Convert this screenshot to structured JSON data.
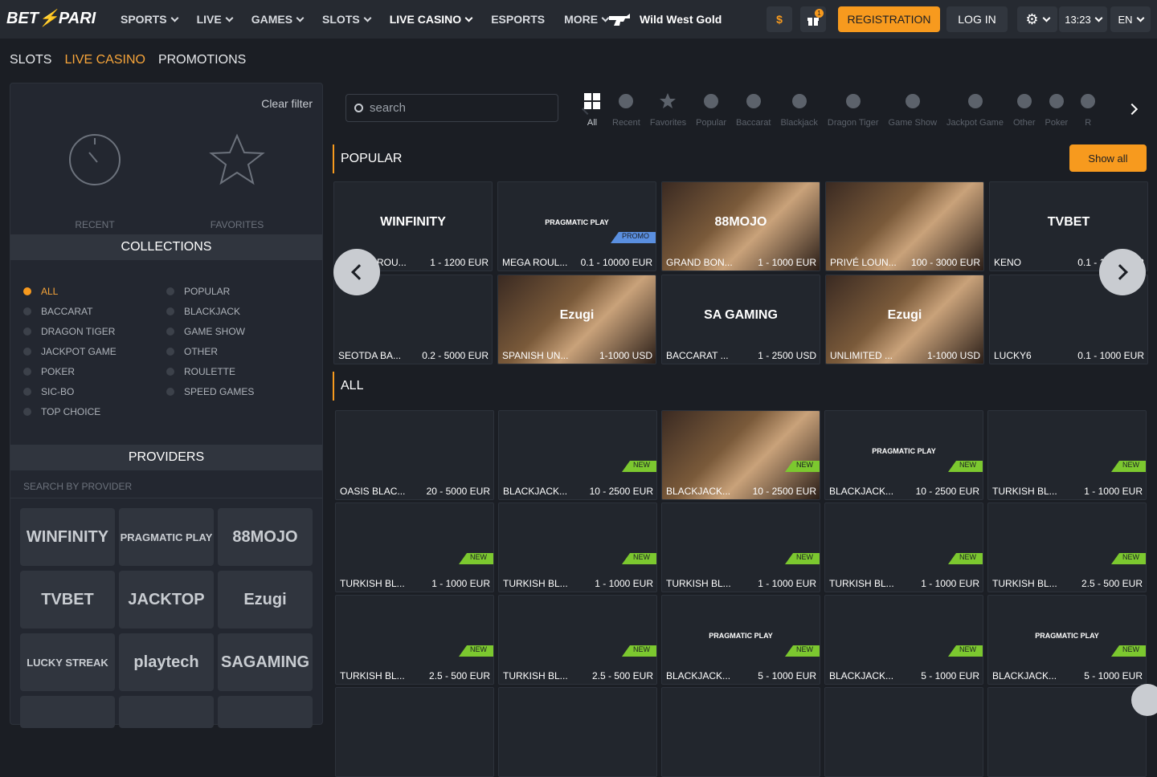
{
  "header": {
    "logo_left": "BET",
    "logo_right": "PARI",
    "nav": [
      {
        "label": "SPORTS",
        "dropdown": true
      },
      {
        "label": "LIVE",
        "dropdown": true
      },
      {
        "label": "GAMES",
        "dropdown": true
      },
      {
        "label": "SLOTS",
        "dropdown": true
      },
      {
        "label": "LIVE CASINO",
        "dropdown": true
      },
      {
        "label": "ESPORTS",
        "dropdown": false
      },
      {
        "label": "MORE",
        "dropdown": true
      }
    ],
    "promo_label": "Wild West Gold",
    "gift_count": "1",
    "registration": "REGISTRATION",
    "login": "LOG IN",
    "time": "13:23",
    "language": "EN",
    "currency_icon": "dollar-icon",
    "accent": "#f79a1e"
  },
  "subnav": [
    {
      "label": "SLOTS",
      "active": false
    },
    {
      "label": "LIVE CASINO",
      "active": true
    },
    {
      "label": "PROMOTIONS",
      "active": false
    }
  ],
  "sidebar": {
    "clear_filter": "Clear filter",
    "recent": "RECENT",
    "favorites": "FAVORITES",
    "collections_title": "COLLECTIONS",
    "collections_left": [
      "ALL",
      "BACCARAT",
      "DRAGON TIGER",
      "JACKPOT GAME",
      "POKER",
      "SIC-BO",
      "TOP CHOICE"
    ],
    "collections_right": [
      "POPULAR",
      "BLACKJACK",
      "GAME SHOW",
      "OTHER",
      "ROULETTE",
      "SPEED GAMES"
    ],
    "active_collection": "ALL",
    "providers_title": "PROVIDERS",
    "provider_search_placeholder": "SEARCH BY PROVIDER",
    "providers": [
      "WINFINITY",
      "PRAGMATIC PLAY",
      "88MOJO",
      "TVBET",
      "JACKTOP",
      "Ezugi",
      "LUCKY STREAK",
      "playtech",
      "SAGAMING"
    ]
  },
  "main": {
    "search_placeholder": "search",
    "categories": [
      "All",
      "Recent",
      "Favorites",
      "Popular",
      "Baccarat",
      "Blackjack",
      "Dragon Tiger",
      "Game Show",
      "Jackpot Game",
      "Other",
      "Poker",
      "R"
    ],
    "popular_title": "POPULAR",
    "show_all": "Show all",
    "all_title": "ALL",
    "popular": [
      {
        "name": "VENICE ROU...",
        "range": "1 - 1200 EUR",
        "logo": "WINFINITY",
        "badge": ""
      },
      {
        "name": "MEGA ROUL...",
        "range": "0.1 - 10000 EUR",
        "logo": "PRAGMATIC PLAY",
        "badge": "PROMO"
      },
      {
        "name": "GRAND BON...",
        "range": "1 - 1000 EUR",
        "logo": "88MOJO",
        "badge": ""
      },
      {
        "name": "PRIVÉ LOUN...",
        "range": "100 - 3000 EUR",
        "logo": "",
        "badge": ""
      },
      {
        "name": "KENO",
        "range": "0.1 - 1000 EUR",
        "logo": "TVBET",
        "badge": ""
      },
      {
        "name": "SEOTDA BA...",
        "range": "0.2 - 5000 EUR",
        "logo": "",
        "badge": ""
      },
      {
        "name": "SPANISH UN...",
        "range": "1-1000 USD",
        "logo": "Ezugi",
        "badge": ""
      },
      {
        "name": "BACCARAT ...",
        "range": "1 - 2500 USD",
        "logo": "SA GAMING",
        "badge": ""
      },
      {
        "name": "UNLIMITED ...",
        "range": "1-1000 USD",
        "logo": "Ezugi",
        "badge": ""
      },
      {
        "name": "LUCKY6",
        "range": "0.1 - 1000 EUR",
        "logo": "",
        "badge": ""
      }
    ],
    "all": [
      {
        "name": "OASIS BLAC...",
        "range": "20 - 5000 EUR",
        "logo": "",
        "badge": ""
      },
      {
        "name": "BLACKJACK...",
        "range": "10 - 2500 EUR",
        "logo": "",
        "badge": "NEW"
      },
      {
        "name": "BLACKJACK...",
        "range": "10 - 2500 EUR",
        "logo": "",
        "badge": "NEW"
      },
      {
        "name": "BLACKJACK...",
        "range": "10 - 2500 EUR",
        "logo": "PRAGMATIC PLAY",
        "badge": "NEW"
      },
      {
        "name": "TURKISH BL...",
        "range": "1 - 1000 EUR",
        "logo": "",
        "badge": "NEW"
      },
      {
        "name": "TURKISH BL...",
        "range": "1 - 1000 EUR",
        "logo": "",
        "badge": "NEW"
      },
      {
        "name": "TURKISH BL...",
        "range": "1 - 1000 EUR",
        "logo": "",
        "badge": "NEW"
      },
      {
        "name": "TURKISH BL...",
        "range": "1 - 1000 EUR",
        "logo": "",
        "badge": "NEW"
      },
      {
        "name": "TURKISH BL...",
        "range": "1 - 1000 EUR",
        "logo": "",
        "badge": "NEW"
      },
      {
        "name": "TURKISH BL...",
        "range": "2.5 - 500 EUR",
        "logo": "",
        "badge": "NEW"
      },
      {
        "name": "TURKISH BL...",
        "range": "2.5 - 500 EUR",
        "logo": "",
        "badge": "NEW"
      },
      {
        "name": "TURKISH BL...",
        "range": "2.5 - 500 EUR",
        "logo": "",
        "badge": "NEW"
      },
      {
        "name": "BLACKJACK...",
        "range": "5 - 1000 EUR",
        "logo": "PRAGMATIC PLAY",
        "badge": "NEW"
      },
      {
        "name": "BLACKJACK...",
        "range": "5 - 1000 EUR",
        "logo": "",
        "badge": "NEW"
      },
      {
        "name": "BLACKJACK...",
        "range": "5 - 1000 EUR",
        "logo": "PRAGMATIC PLAY",
        "badge": "NEW"
      }
    ]
  }
}
